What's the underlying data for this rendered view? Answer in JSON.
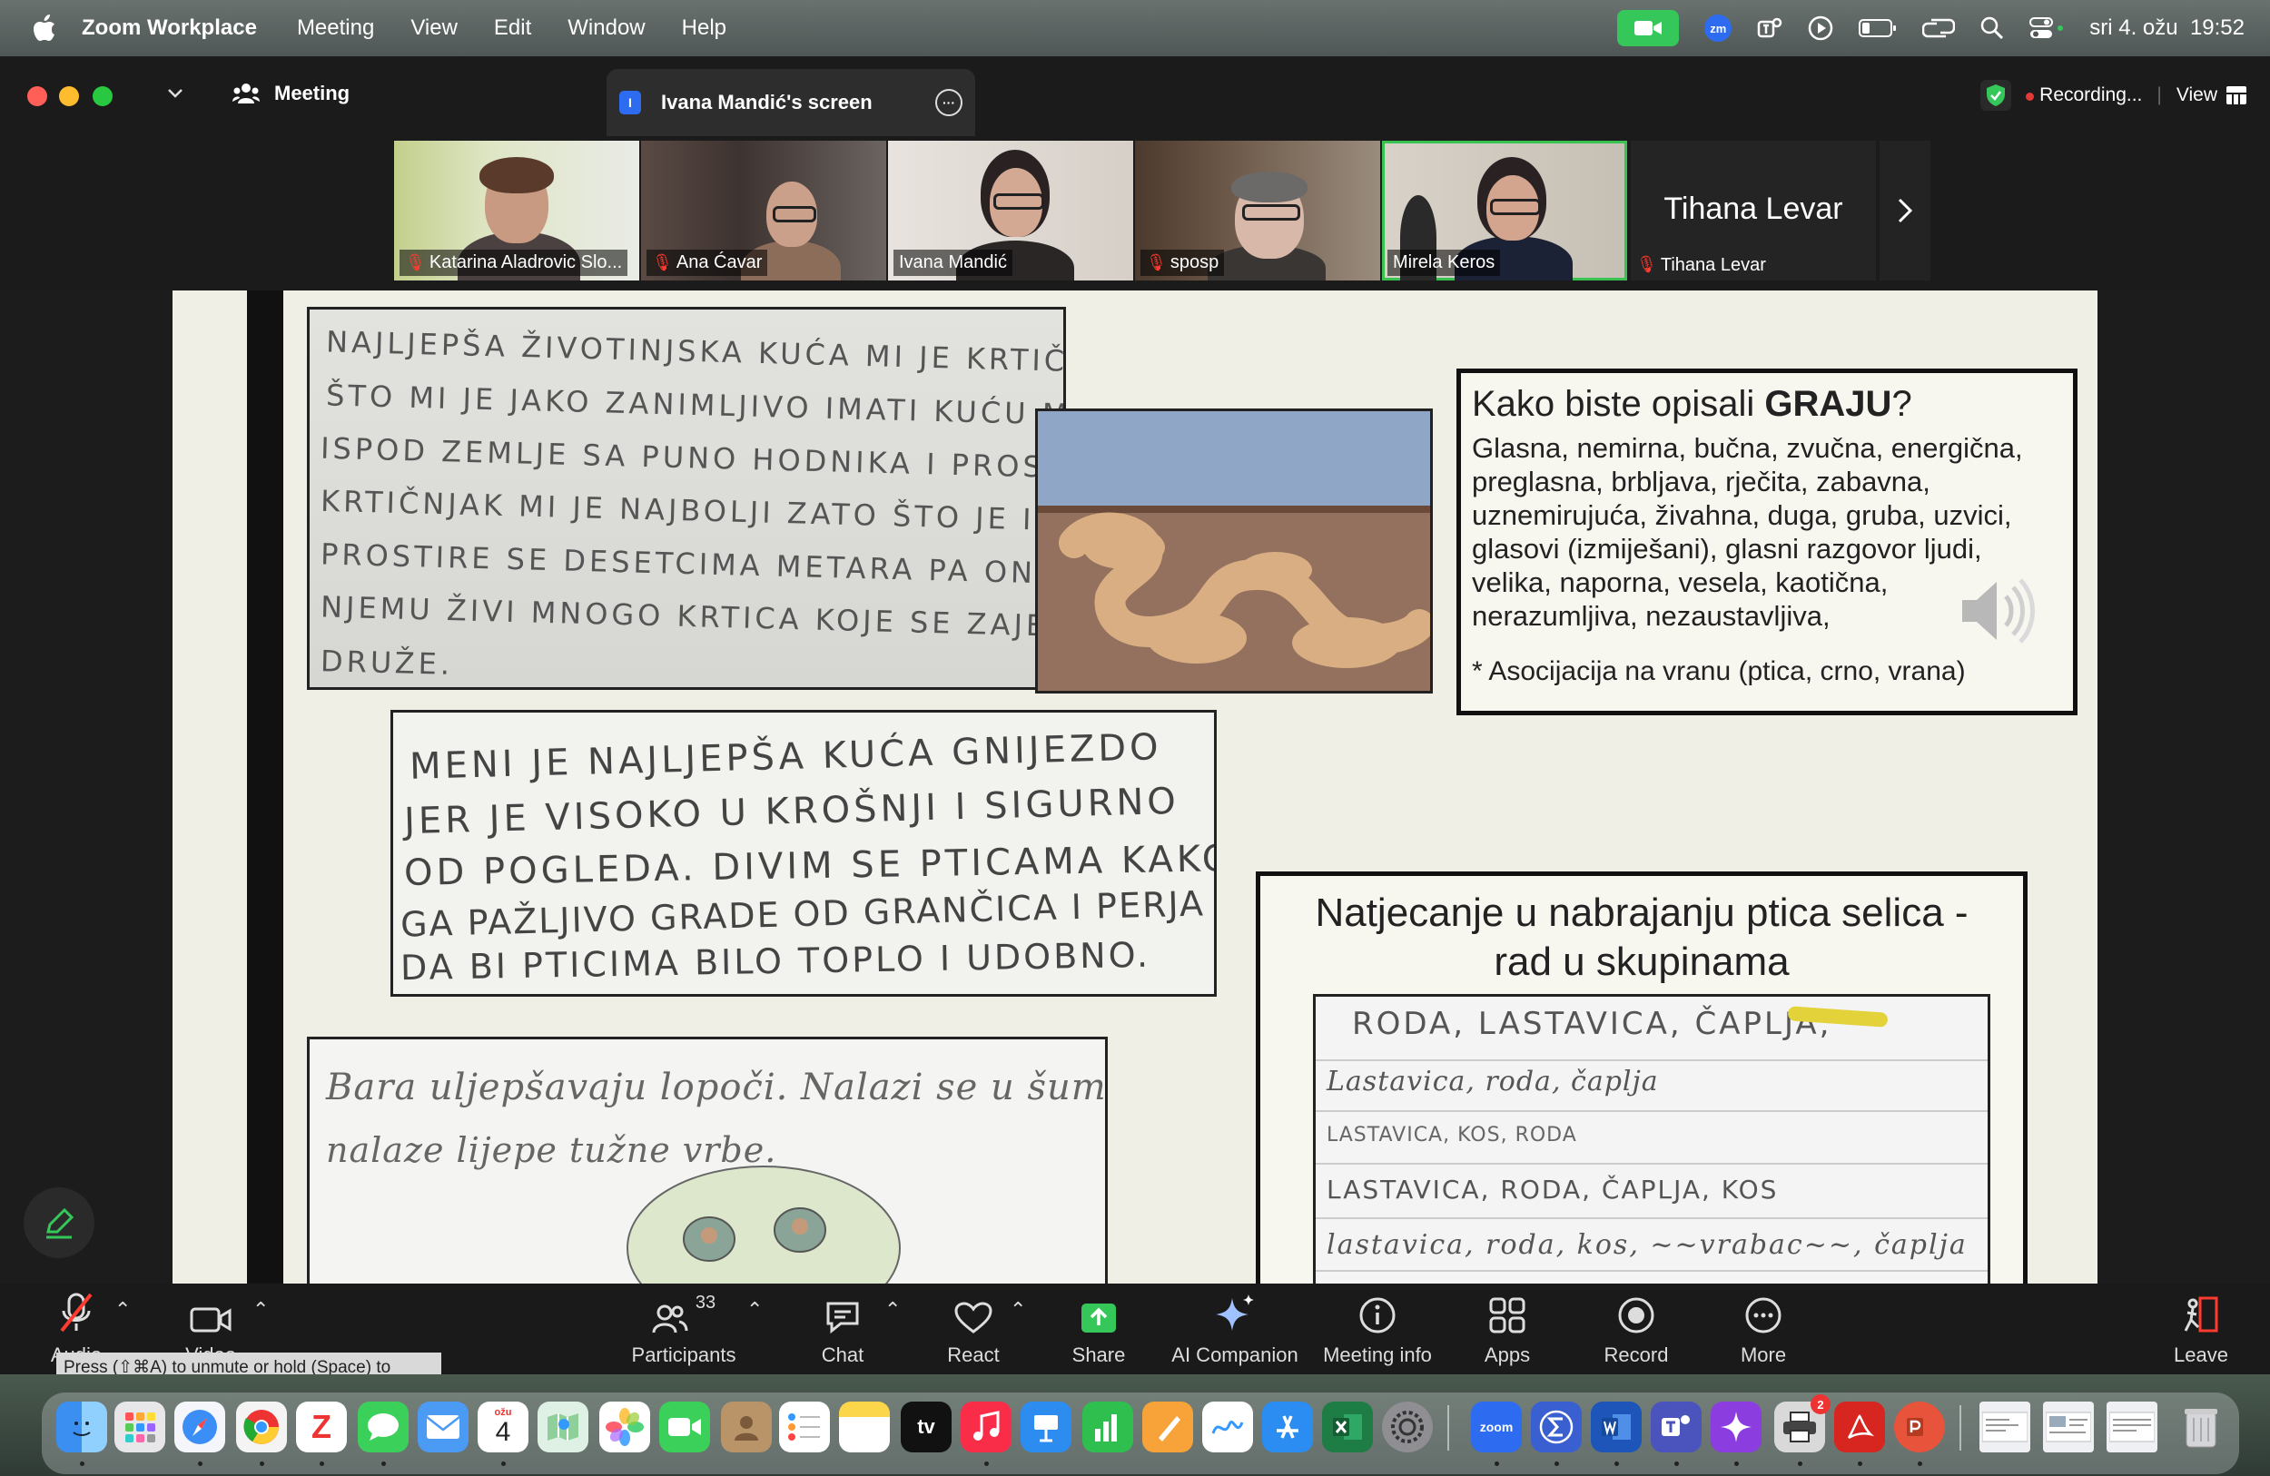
{
  "menubar": {
    "app_name": "Zoom Workplace",
    "menus": [
      "Meeting",
      "View",
      "Edit",
      "Window",
      "Help"
    ],
    "clock": "sri 4. ožu  19:52",
    "zoom_status_label": "zm"
  },
  "window": {
    "meeting_tab": "Meeting",
    "share_tab": "Ivana Mandić's screen",
    "share_badge": "I",
    "recording": "Recording...",
    "view": "View"
  },
  "participants_strip": [
    {
      "name": "Katarina Aladrovic Slo...",
      "muted": true
    },
    {
      "name": "Ana Ćavar",
      "muted": true
    },
    {
      "name": "Ivana Mandić",
      "muted": false
    },
    {
      "name": "sposp",
      "muted": true
    },
    {
      "name": "Mirela Keros",
      "muted": false,
      "active": true
    },
    {
      "name": "Tihana Levar",
      "muted": true,
      "display_name": "Tihana Levar"
    }
  ],
  "slide": {
    "hw1": [
      "NAJLJEPŠA ŽIVOTINJSKA KUĆA MI JE KRTIČNJAK, ZATO",
      "ŠTO MI JE JAKO ZANIMLJIVO IMATI KUĆU METRIMA",
      "ISPOD ZEMLJE SA PUNO HODNIKA I PROSTORIJA.",
      "KRTIČNJAK MI JE NAJBOLJI ZATO ŠTO JE I VELIK I",
      "PROSTIRE SE DESETCIMA METARA PA ONDA U",
      "NJEMU ŽIVI MNOGO KRTICA KOJE SE ZAJEDNO",
      "DRUŽE."
    ],
    "hw2": [
      "MENI JE NAJLJEPŠA KUĆA GNIJEZDO",
      "JER JE VISOKO U KROŠNJI I SIGURNO",
      "OD POGLEDA. DIVIM SE PTICAMA KAKO",
      "GA PAŽLJIVO GRADE OD GRANČICA I PERJA",
      "DA BI PTICIMA BILO TOPLO I UDOBNO."
    ],
    "hw3": [
      "Bara uljepšavaju lopoči. Nalazi se u šumi i oko nje se",
      "nalaze lijepe tužne vrbe."
    ],
    "graja": {
      "title_prefix": "Kako biste opisali ",
      "title_bold": "GRAJU",
      "title_suffix": "?",
      "lines": [
        "Glasna, nemirna, bučna, zvučna, energična,",
        "preglasna, brbljava, rječita, zabavna,",
        "uznemirujuća, živahna, duga, gruba, uzvici,",
        "glasovi (izmiješani), glasni razgovor ljudi,",
        "velika, naporna, vesela, kaotična,",
        "nerazumljiva, nezaustavljiva,"
      ],
      "footnote": "* Asocijacija na vranu (ptica, crno, vrana)"
    },
    "natjecanje": {
      "title_line1": "Natjecanje u nabrajanju ptica selica -",
      "title_line2": "rad u skupinama",
      "rows": [
        "RODA, LASTAVICA, ČAPLJA,",
        "Lastavica, roda, čaplja",
        "LASTAVICA, KOS, RODA",
        "LASTAVICA, RODA, ČAPLJA, KOS",
        "lastavica, roda, kos, ~~vrabac~~, čaplja"
      ]
    }
  },
  "toolbar": {
    "audio": "Audio",
    "video": "Video",
    "participants": "Participants",
    "participants_count": "33",
    "chat": "Chat",
    "react": "React",
    "share": "Share",
    "ai_companion": "AI Companion",
    "meeting_info": "Meeting info",
    "apps": "Apps",
    "record": "Record",
    "more": "More",
    "leave": "Leave"
  },
  "tooltip": "Press (⇧⌘A) to unmute or hold (Space) to temporarily unmute.",
  "dock": {
    "calendar_month": "ožu",
    "calendar_day": "4",
    "tv_label": "tv",
    "zoom_label": "zoom",
    "badge_count": "2"
  },
  "colors": {
    "active_speaker": "#39c24f",
    "share_green": "#35c759",
    "muted_red": "#ff3b30",
    "record_red": "#e53935"
  }
}
